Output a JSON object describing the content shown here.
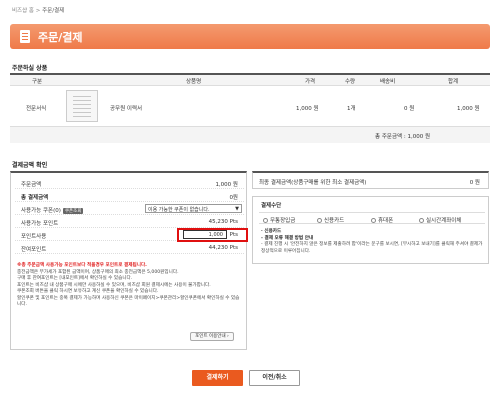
{
  "breadcrumb": {
    "home": "비즈샵 홈",
    "sep": ">",
    "current": "주문/결제"
  },
  "page_title": "주문/결제",
  "products_section": {
    "title": "주문하실 상품",
    "headers": [
      "구분",
      "상품명",
      "가격",
      "수량",
      "배송비",
      "합계"
    ],
    "row": {
      "category": "전문서식",
      "name": "공무원 이력서",
      "price": "1,000 원",
      "qty": "1개",
      "shipping": "0 원",
      "total": "1,000 원"
    },
    "summary": "총 주문금액 : 1,000 원"
  },
  "payment_section": {
    "title": "결제금액 확인",
    "rows": [
      {
        "label": "주문금액",
        "value": "1,000 원"
      },
      {
        "label": "총 결제금액",
        "value": "0원"
      },
      {
        "label": "사용가능 쿠폰(0)",
        "tag": "쿠폰조회",
        "select": "이용 가능한 쿠폰이 없습니다.",
        "select_arrow": "▼"
      },
      {
        "label": "사용가능 포인트",
        "value": "45,230 Pts"
      },
      {
        "label": "포인트사용",
        "input": "1,000",
        "unit": "Pts"
      },
      {
        "label": "잔여포인트",
        "value": "44,230 Pts"
      }
    ],
    "notes": {
      "warn": "※총 주문금액 사용가능 포인트보다 적을경우 포인트로 결제됩니다.",
      "lines": [
        "충전금액은 부가세가 포함된 금액이며, 상품구매의 최소 충전금액은 5,000원입니다.",
        "구매 후 잔여포인트는 [내포인트]에서 확인하실 수 있습니다.",
        "포인트는 비즈샵 내 상품구매 시에만 사용하실 수 있으며, 비즈샵 회원 결제시에는 사용이 불가합니다.",
        "쿠폰조회 버튼을 클릭 하시면 보유하고 계신 쿠폰을 확인하실 수 있습니다.",
        "할인쿠폰 및 포인트는 중복 결제가 가능하며 사용하신 쿠폰은 마이페이지>쿠폰관리>할인쿠폰에서 확인하실 수 있습니다."
      ]
    },
    "point_button": "포인트 이용안내 ›"
  },
  "final_amount": {
    "label": "최종 결제금액(상품구매를 위한 최소 결제금액)",
    "value": "0 원"
  },
  "payment_method": {
    "title": "결제수단",
    "options": [
      "무통장입금",
      "신용카드",
      "휴대폰",
      "실시간계좌이체"
    ],
    "info_title": "· 신용카드",
    "info_lines": [
      "- 결제 오류 해결 방법 안내",
      "- 결제 진행 시 '안전하지 않은 정보를 제출하려 합'이라는 문구를 보시면, [무시하고 보내기]를 클릭해 주셔야 결제가 정상적으로 이루어집니다."
    ]
  },
  "buttons": {
    "pay": "결제하기",
    "cancel": "이전/취소"
  },
  "colors": {
    "accent": "#ef7a49",
    "pay_button": "#ea5a1f",
    "warn": "#e02020",
    "highlight": "#e01010"
  }
}
